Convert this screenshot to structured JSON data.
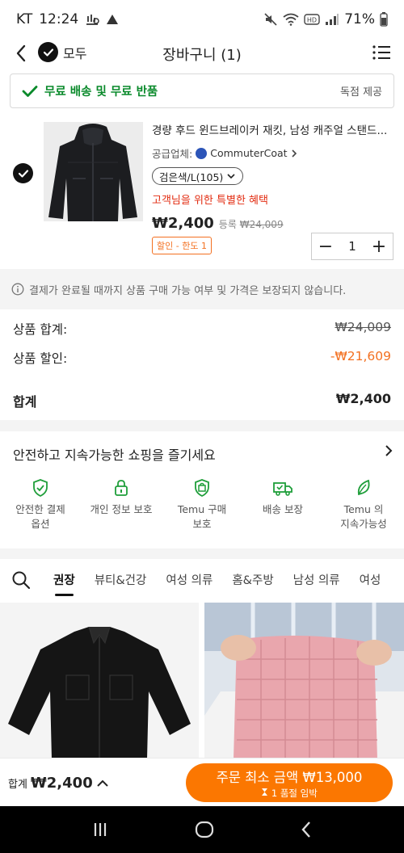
{
  "status_bar": {
    "carrier": "KT",
    "time": "12:24",
    "battery": "71%"
  },
  "header": {
    "select_all_label": "모두",
    "title": "장바구니 (1)"
  },
  "shipping_banner": {
    "text": "무료 배송 및 무료 반품",
    "badge": "독점 제공"
  },
  "product": {
    "title": "경량 후드 윈드브레이커 재킷, 남성 캐주얼 스탠드...",
    "seller_label": "공급업체:",
    "seller_name": "CommuterCoat",
    "variant": "검은색/L(105)",
    "special_offer": "고객님을 위한 특별한 혜택",
    "price": "₩2,400",
    "orig_label": "등록",
    "orig_price": "₩24,009",
    "limit_badge": "할인 - 한도 1",
    "quantity": "1"
  },
  "notice": "결제가 완료될 때까지 상품 구매 가능 여부 및 가격은 보장되지 않습니다.",
  "summary": {
    "subtotal_label": "상품 합계:",
    "subtotal_value": "₩24,009",
    "discount_label": "상품 할인:",
    "discount_value": "-₩21,609",
    "total_label": "합계",
    "total_value": "₩2,400"
  },
  "safe_shopping": {
    "title": "안전하고 지속가능한 쇼핑을 즐기세요",
    "items": [
      {
        "line1": "안전한 결제",
        "line2": "옵션",
        "icon": "shield-check-icon"
      },
      {
        "line1": "개인 정보 보호",
        "line2": "",
        "icon": "lock-icon"
      },
      {
        "line1": "Temu 구매",
        "line2": "보호",
        "icon": "bag-shield-icon"
      },
      {
        "line1": "배송 보장",
        "line2": "",
        "icon": "truck-check-icon"
      },
      {
        "line1": "Temu 의",
        "line2": "지속가능성",
        "icon": "leaf-icon"
      }
    ]
  },
  "categories": {
    "tabs": [
      "권장",
      "뷰티&건강",
      "여성 의류",
      "홈&주방",
      "남성 의류",
      "여성"
    ],
    "active_index": 0
  },
  "bottom_bar": {
    "total_label": "합계",
    "total_value": "₩2,400",
    "checkout_main": "주문 최소 금액 ₩13,000",
    "checkout_sub": "1 품절 임박"
  },
  "colors": {
    "accent": "#fb7701",
    "success": "#0a8a2b",
    "danger": "#e22b10"
  }
}
